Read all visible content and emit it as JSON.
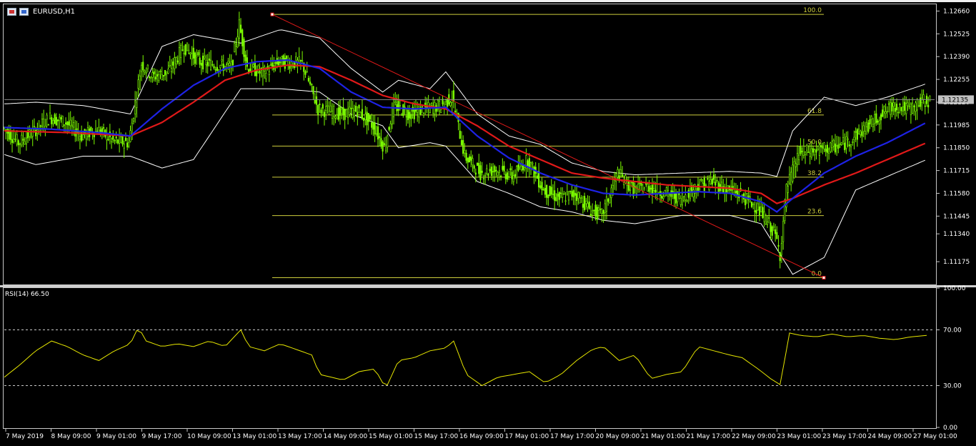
{
  "window": {
    "symbol_label": "EURUSD,H1"
  },
  "colors": {
    "background": "#000000",
    "candles": "#7CFC00",
    "ma_fast": "#1E22E6",
    "ma_slow": "#E11919",
    "bands": "#FFFFFF",
    "fibo": "#CDCD3C",
    "trendline": "#E11919",
    "rsi": "#E6E600",
    "axis_text": "#FFFFFF",
    "price_tag_bg": "#C0C0C0"
  },
  "chart_data": [
    {
      "type": "candlestick",
      "title": "EURUSD,H1",
      "ylim": [
        1.1104,
        1.127
      ],
      "y_ticks": [
        "1.12660",
        "1.12525",
        "1.12390",
        "1.12255",
        "1.12120",
        "1.11985",
        "1.11850",
        "1.11715",
        "1.11580",
        "1.11445",
        "1.11340",
        "1.11175"
      ],
      "current_price": "1.12135",
      "x_ticks": [
        "7 May 2019",
        "8 May 09:00",
        "9 May 01:00",
        "9 May 17:00",
        "10 May 09:00",
        "13 May 01:00",
        "13 May 17:00",
        "14 May 09:00",
        "15 May 01:00",
        "15 May 17:00",
        "16 May 09:00",
        "17 May 01:00",
        "17 May 17:00",
        "20 May 09:00",
        "21 May 01:00",
        "21 May 17:00",
        "22 May 09:00",
        "23 May 01:00",
        "23 May 17:00",
        "24 May 09:00",
        "27 May 01:00"
      ],
      "close_series": [
        [
          0,
          1.1197
        ],
        [
          10,
          1.1188
        ],
        [
          20,
          1.1195
        ],
        [
          30,
          1.1203
        ],
        [
          40,
          1.12
        ],
        [
          50,
          1.1192
        ],
        [
          60,
          1.1196
        ],
        [
          70,
          1.1189
        ],
        [
          80,
          1.1188
        ],
        [
          88,
          1.1235
        ],
        [
          95,
          1.1227
        ],
        [
          105,
          1.123
        ],
        [
          115,
          1.1245
        ],
        [
          125,
          1.1236
        ],
        [
          135,
          1.1234
        ],
        [
          145,
          1.1233
        ],
        [
          150,
          1.1258
        ],
        [
          155,
          1.1233
        ],
        [
          165,
          1.1229
        ],
        [
          175,
          1.1236
        ],
        [
          190,
          1.1235
        ],
        [
          200,
          1.1208
        ],
        [
          215,
          1.1205
        ],
        [
          225,
          1.1207
        ],
        [
          235,
          1.1198
        ],
        [
          242,
          1.1185
        ],
        [
          248,
          1.121
        ],
        [
          258,
          1.1205
        ],
        [
          268,
          1.1208
        ],
        [
          278,
          1.121
        ],
        [
          285,
          1.1215
        ],
        [
          293,
          1.118
        ],
        [
          303,
          1.117
        ],
        [
          313,
          1.1172
        ],
        [
          323,
          1.1168
        ],
        [
          333,
          1.1178
        ],
        [
          343,
          1.116
        ],
        [
          353,
          1.1155
        ],
        [
          363,
          1.1158
        ],
        [
          373,
          1.1148
        ],
        [
          380,
          1.1145
        ],
        [
          390,
          1.117
        ],
        [
          400,
          1.116
        ],
        [
          410,
          1.1162
        ],
        [
          420,
          1.1158
        ],
        [
          430,
          1.1155
        ],
        [
          440,
          1.1162
        ],
        [
          450,
          1.1165
        ],
        [
          460,
          1.116
        ],
        [
          468,
          1.1157
        ],
        [
          478,
          1.115
        ],
        [
          486,
          1.114
        ],
        [
          490,
          1.1133
        ],
        [
          493,
          1.1122
        ],
        [
          497,
          1.116
        ],
        [
          505,
          1.1182
        ],
        [
          515,
          1.1183
        ],
        [
          525,
          1.1185
        ],
        [
          535,
          1.1188
        ],
        [
          545,
          1.1195
        ],
        [
          555,
          1.1203
        ],
        [
          565,
          1.121
        ],
        [
          575,
          1.1208
        ],
        [
          585,
          1.1213
        ]
      ],
      "ma_fast": [
        [
          0,
          1.1197
        ],
        [
          30,
          1.1196
        ],
        [
          60,
          1.1194
        ],
        [
          80,
          1.1192
        ],
        [
          100,
          1.1208
        ],
        [
          120,
          1.1222
        ],
        [
          140,
          1.1232
        ],
        [
          160,
          1.1236
        ],
        [
          180,
          1.1237
        ],
        [
          200,
          1.1232
        ],
        [
          220,
          1.1218
        ],
        [
          240,
          1.1209
        ],
        [
          260,
          1.1208
        ],
        [
          280,
          1.1209
        ],
        [
          300,
          1.1192
        ],
        [
          320,
          1.1179
        ],
        [
          340,
          1.117
        ],
        [
          360,
          1.1163
        ],
        [
          380,
          1.1158
        ],
        [
          400,
          1.1157
        ],
        [
          420,
          1.1158
        ],
        [
          440,
          1.1159
        ],
        [
          460,
          1.1158
        ],
        [
          480,
          1.1153
        ],
        [
          490,
          1.1147
        ],
        [
          500,
          1.1155
        ],
        [
          520,
          1.117
        ],
        [
          540,
          1.118
        ],
        [
          560,
          1.1188
        ],
        [
          585,
          1.12
        ]
      ],
      "ma_slow": [
        [
          0,
          1.1195
        ],
        [
          40,
          1.1194
        ],
        [
          80,
          1.1192
        ],
        [
          100,
          1.12
        ],
        [
          120,
          1.1212
        ],
        [
          140,
          1.1225
        ],
        [
          160,
          1.1231
        ],
        [
          180,
          1.1234
        ],
        [
          200,
          1.1233
        ],
        [
          220,
          1.1225
        ],
        [
          240,
          1.1216
        ],
        [
          260,
          1.1211
        ],
        [
          280,
          1.1208
        ],
        [
          300,
          1.1198
        ],
        [
          320,
          1.1186
        ],
        [
          340,
          1.1178
        ],
        [
          360,
          1.117
        ],
        [
          380,
          1.1167
        ],
        [
          400,
          1.1165
        ],
        [
          420,
          1.1163
        ],
        [
          440,
          1.1162
        ],
        [
          460,
          1.1161
        ],
        [
          480,
          1.1158
        ],
        [
          490,
          1.1152
        ],
        [
          500,
          1.1155
        ],
        [
          520,
          1.1163
        ],
        [
          540,
          1.117
        ],
        [
          560,
          1.1178
        ],
        [
          585,
          1.1188
        ]
      ],
      "bb_upper": [
        [
          0,
          1.1211
        ],
        [
          20,
          1.1212
        ],
        [
          50,
          1.121
        ],
        [
          80,
          1.1205
        ],
        [
          100,
          1.1245
        ],
        [
          120,
          1.1252
        ],
        [
          150,
          1.1247
        ],
        [
          175,
          1.1255
        ],
        [
          200,
          1.125
        ],
        [
          220,
          1.1232
        ],
        [
          240,
          1.1218
        ],
        [
          250,
          1.1225
        ],
        [
          270,
          1.122
        ],
        [
          280,
          1.123
        ],
        [
          300,
          1.1205
        ],
        [
          320,
          1.1192
        ],
        [
          340,
          1.1187
        ],
        [
          360,
          1.1176
        ],
        [
          380,
          1.1171
        ],
        [
          400,
          1.1169
        ],
        [
          430,
          1.117
        ],
        [
          460,
          1.1171
        ],
        [
          480,
          1.117
        ],
        [
          490,
          1.1168
        ],
        [
          500,
          1.1195
        ],
        [
          520,
          1.1215
        ],
        [
          540,
          1.121
        ],
        [
          560,
          1.1215
        ],
        [
          585,
          1.1223
        ]
      ],
      "bb_lower": [
        [
          0,
          1.1181
        ],
        [
          20,
          1.1175
        ],
        [
          50,
          1.118
        ],
        [
          80,
          1.118
        ],
        [
          100,
          1.1173
        ],
        [
          120,
          1.1178
        ],
        [
          150,
          1.122
        ],
        [
          175,
          1.122
        ],
        [
          200,
          1.1218
        ],
        [
          220,
          1.1205
        ],
        [
          240,
          1.1198
        ],
        [
          250,
          1.1185
        ],
        [
          270,
          1.1188
        ],
        [
          280,
          1.1186
        ],
        [
          300,
          1.1165
        ],
        [
          320,
          1.1158
        ],
        [
          340,
          1.115
        ],
        [
          360,
          1.1147
        ],
        [
          380,
          1.1142
        ],
        [
          400,
          1.114
        ],
        [
          430,
          1.1145
        ],
        [
          460,
          1.1145
        ],
        [
          480,
          1.114
        ],
        [
          490,
          1.1125
        ],
        [
          500,
          1.111
        ],
        [
          520,
          1.112
        ],
        [
          540,
          1.116
        ],
        [
          560,
          1.1168
        ],
        [
          585,
          1.1178
        ]
      ],
      "fibonacci": {
        "high": 1.1264,
        "low": 1.1108,
        "levels": [
          {
            "ratio": 1.0,
            "label": "100.0"
          },
          {
            "ratio": 0.618,
            "label": "61.8"
          },
          {
            "ratio": 0.5,
            "label": "50.0"
          },
          {
            "ratio": 0.382,
            "label": "38.2"
          },
          {
            "ratio": 0.236,
            "label": "23.6"
          },
          {
            "ratio": 0.0,
            "label": "0.0"
          }
        ]
      },
      "trendline": {
        "from": [
          150,
          1.1264
        ],
        "to": [
          493,
          1.1108
        ]
      }
    },
    {
      "type": "line",
      "title": "RSI(14) 66.50",
      "ylim": [
        0,
        100
      ],
      "y_ticks": [
        "100.00",
        "70.00",
        "30.00",
        "0.00"
      ],
      "levels": [
        70,
        30
      ],
      "series": [
        {
          "values": [
            [
              0,
              36
            ],
            [
              10,
              45
            ],
            [
              20,
              55
            ],
            [
              30,
              62
            ],
            [
              40,
              58
            ],
            [
              50,
              52
            ],
            [
              60,
              48
            ],
            [
              70,
              55
            ],
            [
              80,
              60
            ],
            [
              85,
              72
            ],
            [
              90,
              62
            ],
            [
              100,
              58
            ],
            [
              110,
              60
            ],
            [
              120,
              58
            ],
            [
              130,
              62
            ],
            [
              140,
              58
            ],
            [
              150,
              70
            ],
            [
              155,
              58
            ],
            [
              165,
              55
            ],
            [
              175,
              60
            ],
            [
              185,
              56
            ],
            [
              195,
              52
            ],
            [
              200,
              38
            ],
            [
              215,
              34
            ],
            [
              225,
              40
            ],
            [
              235,
              42
            ],
            [
              242,
              28
            ],
            [
              250,
              48
            ],
            [
              260,
              50
            ],
            [
              270,
              55
            ],
            [
              280,
              57
            ],
            [
              285,
              62
            ],
            [
              293,
              38
            ],
            [
              303,
              30
            ],
            [
              313,
              36
            ],
            [
              323,
              38
            ],
            [
              333,
              40
            ],
            [
              343,
              32
            ],
            [
              353,
              38
            ],
            [
              363,
              48
            ],
            [
              373,
              56
            ],
            [
              380,
              58
            ],
            [
              390,
              48
            ],
            [
              400,
              52
            ],
            [
              410,
              35
            ],
            [
              420,
              38
            ],
            [
              430,
              40
            ],
            [
              440,
              58
            ],
            [
              450,
              55
            ],
            [
              460,
              52
            ],
            [
              468,
              50
            ],
            [
              478,
              42
            ],
            [
              486,
              35
            ],
            [
              493,
              30
            ],
            [
              497,
              68
            ],
            [
              505,
              66
            ],
            [
              515,
              65
            ],
            [
              525,
              67
            ],
            [
              535,
              65
            ],
            [
              545,
              66
            ],
            [
              555,
              64
            ],
            [
              565,
              63
            ],
            [
              575,
              65
            ],
            [
              585,
              66
            ]
          ]
        }
      ]
    }
  ]
}
